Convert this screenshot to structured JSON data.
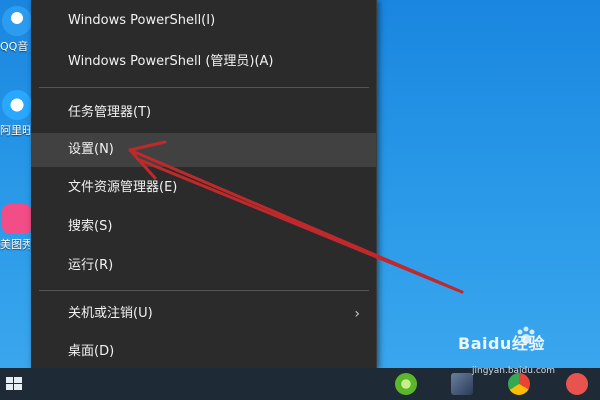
{
  "desktop": {
    "icons": [
      {
        "label": "QQ音"
      },
      {
        "label": "阿里旺"
      },
      {
        "label": "美图秀"
      }
    ]
  },
  "menu": {
    "items": [
      {
        "label": "Windows PowerShell(I)"
      },
      {
        "label": "Windows PowerShell (管理员)(A)"
      },
      {
        "label": "任务管理器(T)"
      },
      {
        "label": "设置(N)"
      },
      {
        "label": "文件资源管理器(E)"
      },
      {
        "label": "搜索(S)"
      },
      {
        "label": "运行(R)"
      },
      {
        "label": "关机或注销(U)"
      },
      {
        "label": "桌面(D)"
      }
    ],
    "submenu_arrow": "›",
    "hover_color": "#414141",
    "background_color": "#2b2b2b"
  },
  "annotation": {
    "arrow_color": "#c0292b",
    "points_to": "设置(N)"
  },
  "taskbar": {
    "icons": [
      "start-icon",
      "app-green-icon",
      "app-doc-icon",
      "chrome-icon",
      "heart-icon"
    ]
  },
  "watermark": {
    "brand": "Baidu经验",
    "url": "jingyan.baidu.com"
  }
}
